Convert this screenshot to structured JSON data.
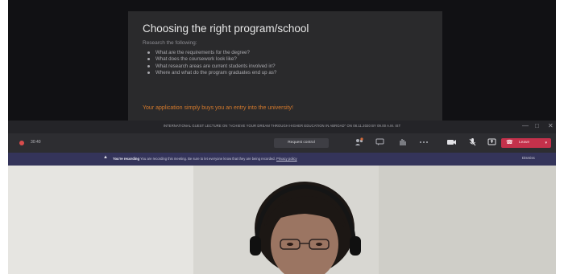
{
  "slide": {
    "title": "Choosing the right program/school",
    "subtitle": "Research the following:",
    "items": [
      "What are the requirements for the degree?",
      "What does the coursework look like?",
      "What research areas are current students involved in?",
      "Where and what do the program graduates end up as?"
    ],
    "footer": "Your application simply buys you an entry into the university!",
    "footer_color": "#d57a2c"
  },
  "window": {
    "title": "INTERNATIONAL GUEST LECTURE ON \"ACHIEVE YOUR DREAM THROUGH HIGHER EDUCATION IN ABROAD\" ON 08.11.2020 BY 09.00 A.M. IST",
    "minimize": "—",
    "maximize": "□",
    "close": "✕"
  },
  "meeting": {
    "timer": "30:40",
    "request_control": "Request control",
    "leave": "Leave",
    "leave_color": "#c4314b",
    "recording_color": "#d84c4c",
    "icons": [
      "people-icon",
      "chat-icon",
      "raise-hand-icon",
      "more-icon",
      "camera-icon",
      "mic-icon",
      "share-icon",
      "phone-icon"
    ]
  },
  "banner": {
    "title": "You're recording",
    "text": "You are recording this meeting. Be sure to let everyone know that they are being recorded.",
    "privacy": "Privacy policy",
    "dismiss": "Dismiss"
  }
}
